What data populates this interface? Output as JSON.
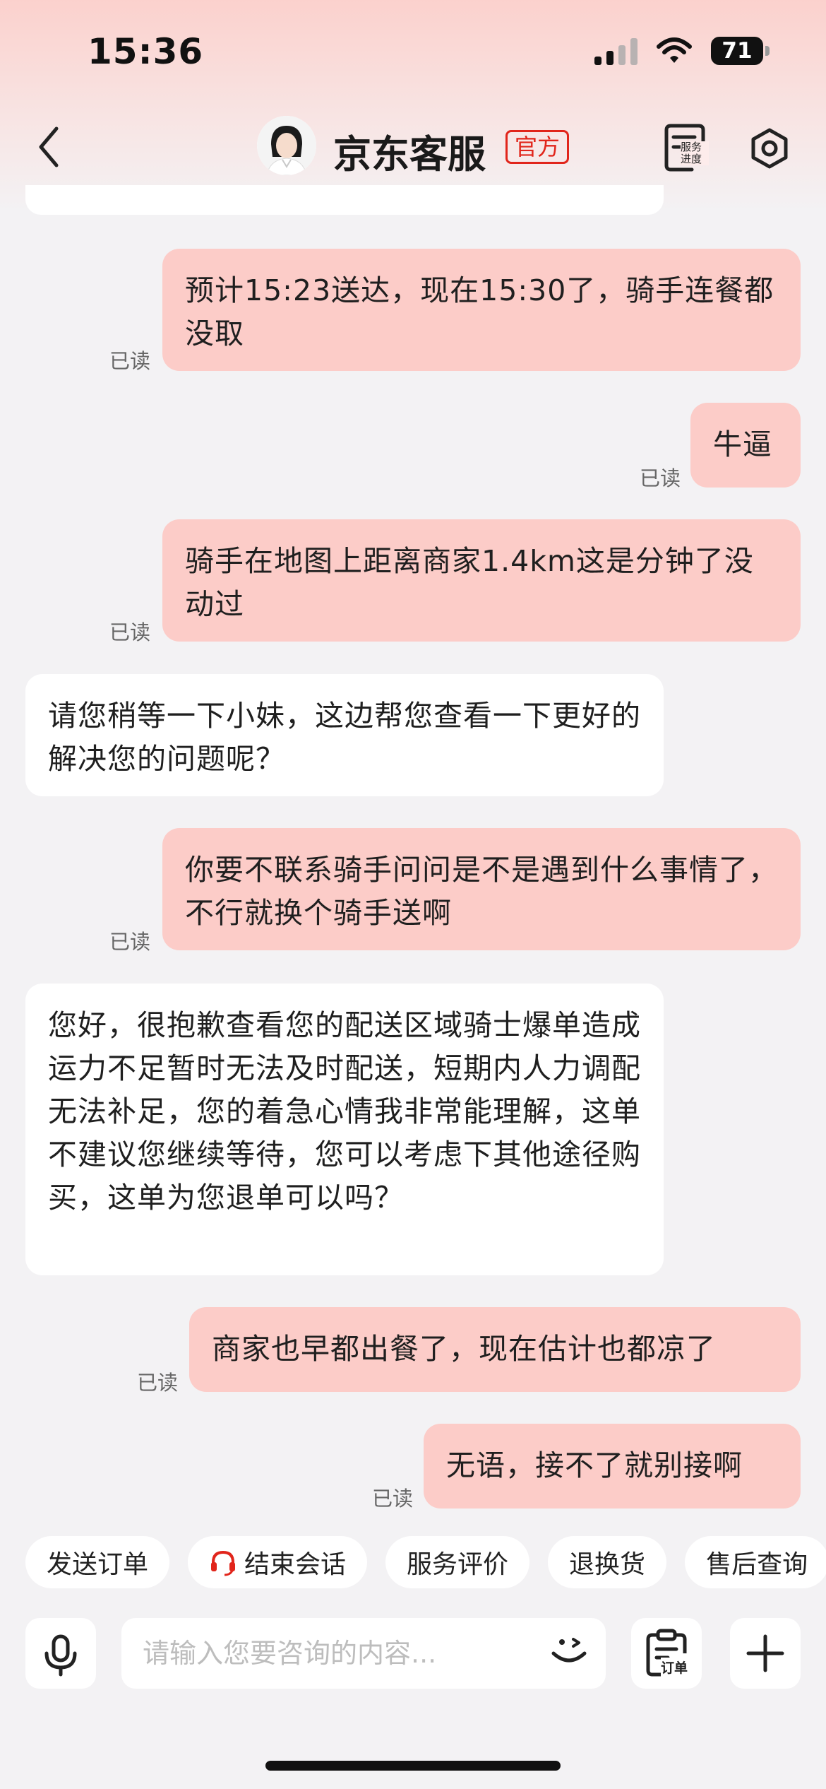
{
  "status_bar": {
    "time": "15:36",
    "battery": "71"
  },
  "header": {
    "title": "京东客服",
    "badge": "官方",
    "service_progress_label": "服务进度",
    "icons": [
      "back-arrow",
      "avatar",
      "service-progress-icon",
      "settings-hexagon-icon"
    ]
  },
  "messages": [
    {
      "from": "me",
      "text": "预计15:23送达，现在15:30了，骑手连餐都没取",
      "status": "已读"
    },
    {
      "from": "me",
      "text": "牛逼",
      "status": "已读"
    },
    {
      "from": "me",
      "text": "骑手在地图上距离商家1.4km这是分钟了没动过",
      "status": "已读"
    },
    {
      "from": "agent",
      "text": "请您稍等一下小妹，这边帮您查看一下更好的解决您的问题呢？"
    },
    {
      "from": "me",
      "text": "你要不联系骑手问问是不是遇到什么事情了，不行就换个骑手送啊",
      "status": "已读"
    },
    {
      "from": "agent",
      "text": "您好，很抱歉查看您的配送区域骑士爆单造成运力不足暂时无法及时配送，短期内人力调配无法补足，您的着急心情我非常能理解，这单不建议您继续等待，您可以考虑下其他途径购买，这单为您退单可以吗？"
    },
    {
      "from": "me",
      "text": "商家也早都出餐了，现在估计也都凉了",
      "status": "已读"
    },
    {
      "from": "me",
      "text": "无语，接不了就别接啊",
      "status": "已读"
    }
  ],
  "quick_actions": [
    "发送订单",
    "结束会话",
    "服务评价",
    "退换货",
    "售后查询"
  ],
  "input": {
    "placeholder": "请输入您要咨询的内容...",
    "order_label": "订单"
  },
  "colors": {
    "accent": "#e1251b",
    "my_bubble": "#fcccc8",
    "agent_bubble": "#ffffff",
    "background": "#f3f2f4"
  }
}
